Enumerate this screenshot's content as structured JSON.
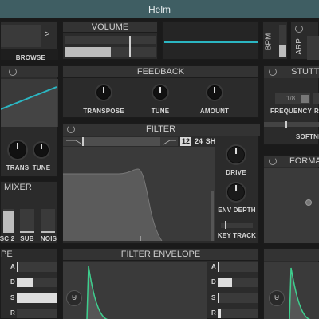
{
  "window": {
    "title": "Helm"
  },
  "colors": {
    "accent": "#2bb6c2",
    "envelope": "#3ecf8e",
    "panel": "#2b2b2b",
    "header": "#333333"
  },
  "patch_browser": {
    "next_label": ">",
    "browse_label": "BROWSE"
  },
  "volume": {
    "title": "VOLUME"
  },
  "bpm": {
    "label": "BPM"
  },
  "arp": {
    "label": "ARP"
  },
  "stutter": {
    "title": "STUTT",
    "frequency_label": "FREQUENCY",
    "frequency_value": "1/8",
    "r_label": "R",
    "softness_label": "SOFTNE"
  },
  "feedback": {
    "title": "FEEDBACK",
    "knobs": [
      "TRANSPOSE",
      "TUNE",
      "AMOUNT"
    ]
  },
  "osc": {
    "trans_label": "TRANS",
    "tune_label": "TUNE"
  },
  "filter": {
    "title": "FILTER",
    "slope_12": "12",
    "slope_24": "24",
    "slope_sh": "SH",
    "drive_label": "DRIVE",
    "env_depth_label": "ENV DEPTH",
    "key_track_label": "KEY TRACK"
  },
  "formant": {
    "title": "FORMA"
  },
  "mixer": {
    "title": "MIXER",
    "channels": [
      "SC 2",
      "SUB",
      "NOIS"
    ]
  },
  "amp_env": {
    "title": "PE"
  },
  "filter_envelope": {
    "title": "FILTER ENVELOPE",
    "adsr": [
      "A",
      "D",
      "S",
      "R"
    ]
  },
  "left_env": {
    "adsr": [
      "A",
      "D",
      "S",
      "R"
    ]
  }
}
